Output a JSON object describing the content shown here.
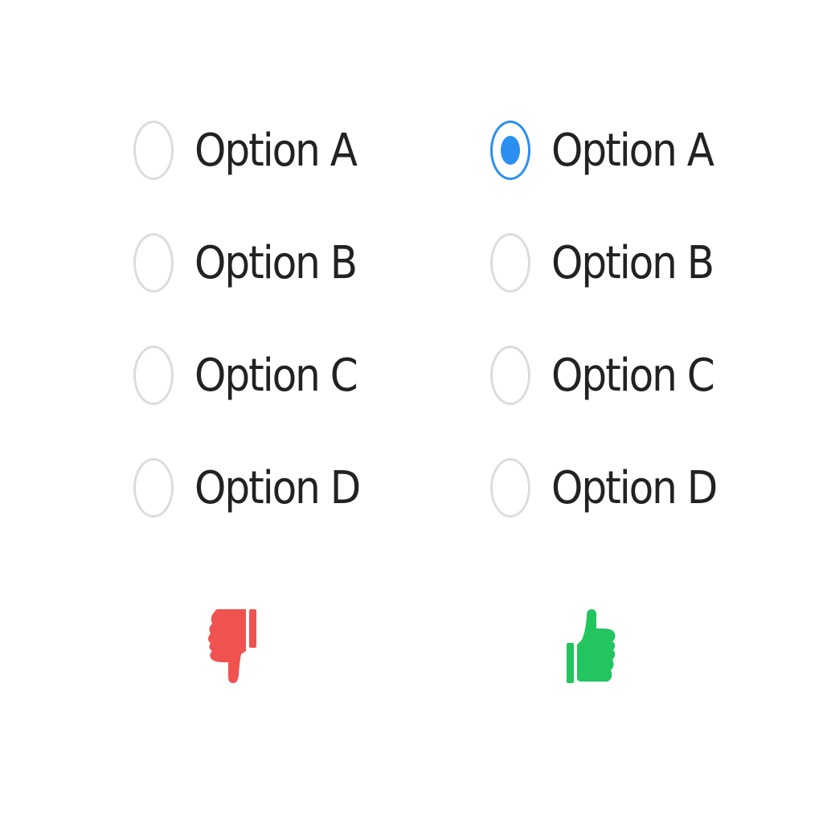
{
  "left_group": {
    "options": [
      {
        "label": "Option A",
        "selected": false
      },
      {
        "label": "Option B",
        "selected": false
      },
      {
        "label": "Option C",
        "selected": false
      },
      {
        "label": "Option D",
        "selected": false
      }
    ]
  },
  "right_group": {
    "options": [
      {
        "label": "Option A",
        "selected": true
      },
      {
        "label": "Option B",
        "selected": false
      },
      {
        "label": "Option C",
        "selected": false
      },
      {
        "label": "Option D",
        "selected": false
      }
    ]
  },
  "icons": {
    "left": {
      "name": "thumbs-down-icon",
      "color": "#f0524f"
    },
    "right": {
      "name": "thumbs-up-icon",
      "color": "#22c55e"
    }
  },
  "colors": {
    "accent": "#2a8ff0",
    "radio_border": "#dcdcdc",
    "text": "#222222"
  }
}
